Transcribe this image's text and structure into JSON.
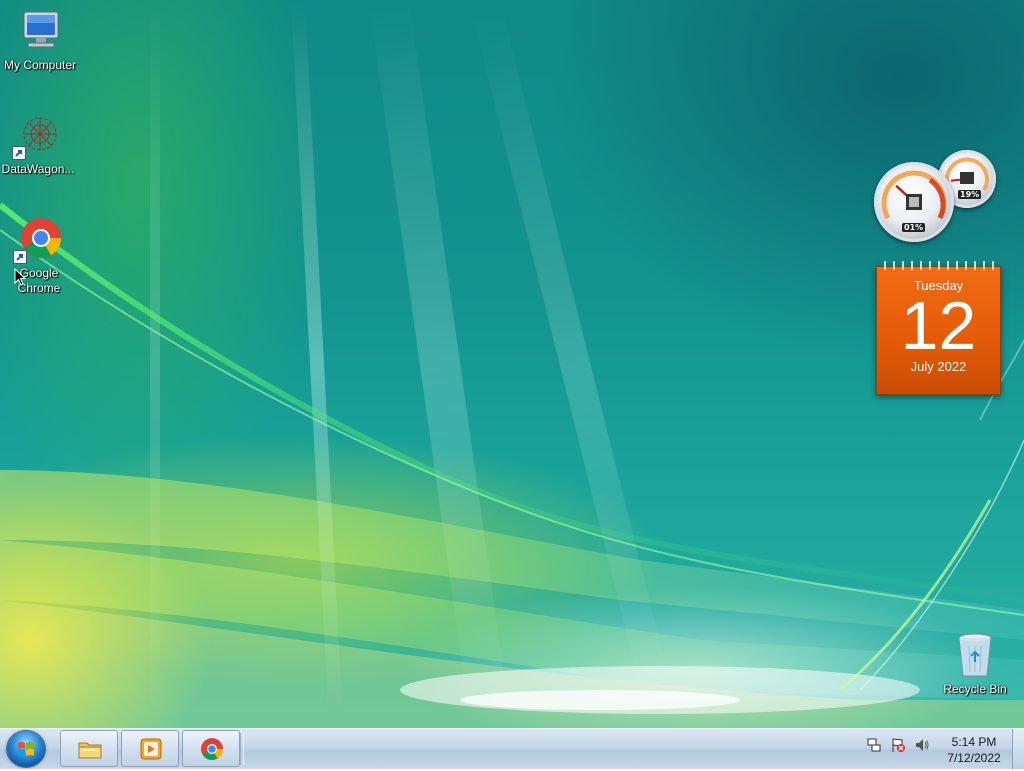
{
  "desktop": {
    "icons": [
      {
        "label": "My Computer",
        "icon": "computer-icon",
        "shortcut": false
      },
      {
        "label": "DataWagon...",
        "icon": "datawagon-icon",
        "shortcut": true
      },
      {
        "label": "Google Chrome",
        "icon": "chrome-icon",
        "shortcut": true
      },
      {
        "label": "Recycle Bin",
        "icon": "recycle-bin-icon",
        "shortcut": false
      }
    ]
  },
  "gadgets": {
    "cpu_meter": {
      "cpu_label": "01%",
      "memory_label": "19%",
      "cpu_value": 0.01,
      "memory_value": 0.19
    },
    "calendar": {
      "weekday": "Tuesday",
      "day": "12",
      "month_year": "July 2022",
      "color": "#e8600c"
    }
  },
  "taskbar": {
    "start_button": "start-orb-icon",
    "pinned": [
      {
        "name": "Windows Explorer",
        "icon": "folder-icon"
      },
      {
        "name": "Windows Media Player",
        "icon": "media-player-icon"
      },
      {
        "name": "Google Chrome",
        "icon": "chrome-icon"
      }
    ],
    "tray_icons": [
      "network-icon",
      "action-center-icon",
      "volume-icon"
    ],
    "clock": {
      "time": "5:14 PM",
      "date": "7/12/2022"
    }
  }
}
